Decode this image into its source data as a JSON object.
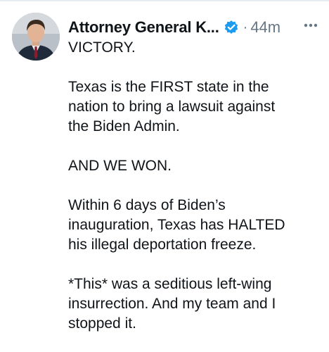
{
  "tweet": {
    "author": {
      "display_name": "Attorney General K...",
      "verified": true,
      "avatar": "profile-photo"
    },
    "timestamp_separator": "·",
    "timestamp": "44m",
    "more_icon": "more-horizontal-icon",
    "paragraphs": [
      [
        "VICTORY."
      ],
      [
        "Texas is the FIRST state in the",
        "nation to bring a lawsuit against",
        "the Biden Admin."
      ],
      [
        "AND WE WON."
      ],
      [
        "Within 6 days of Biden’s",
        "inauguration, Texas has HALTED",
        "his illegal deportation freeze."
      ],
      [
        "*This* was a seditious left-wing",
        "insurrection. And my team and I",
        "stopped it."
      ]
    ]
  },
  "colors": {
    "text": "#0f1419",
    "secondary": "#657786",
    "verified": "#1d9bf0",
    "divider": "#e6ecf0"
  }
}
